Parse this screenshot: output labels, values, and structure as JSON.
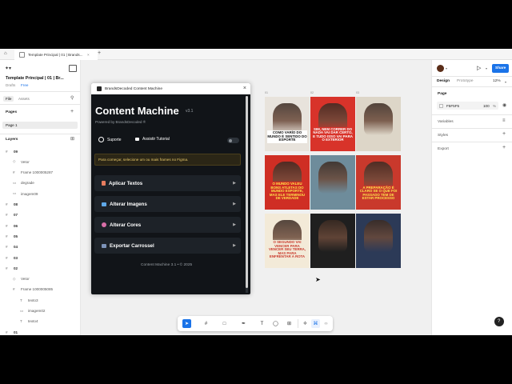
{
  "browser_tab": {
    "title": "Template Principal | 01 | Brands..."
  },
  "file": {
    "name": "Template Principal | 01 | Br...",
    "status": "Drafts",
    "plan": "Free"
  },
  "left_tabs": {
    "file": "File",
    "assets": "Assets"
  },
  "pages": {
    "title": "Pages",
    "items": [
      "Page 1"
    ]
  },
  "layers": {
    "title": "Layers",
    "items": [
      {
        "label": "09",
        "indent": 0,
        "kind": "frame"
      },
      {
        "label": "Vetor",
        "indent": 1,
        "kind": "vector"
      },
      {
        "label": "Frame 1000005287",
        "indent": 1,
        "kind": "frame"
      },
      {
        "label": "degrade",
        "indent": 1,
        "kind": "rect"
      },
      {
        "label": "imagem09",
        "indent": 1,
        "kind": "rect"
      },
      {
        "label": "08",
        "indent": 0,
        "kind": "frame"
      },
      {
        "label": "07",
        "indent": 0,
        "kind": "frame"
      },
      {
        "label": "06",
        "indent": 0,
        "kind": "frame"
      },
      {
        "label": "05",
        "indent": 0,
        "kind": "frame"
      },
      {
        "label": "04",
        "indent": 0,
        "kind": "frame"
      },
      {
        "label": "03",
        "indent": 0,
        "kind": "frame"
      },
      {
        "label": "02",
        "indent": 0,
        "kind": "frame"
      },
      {
        "label": "Vetor",
        "indent": 1,
        "kind": "vector"
      },
      {
        "label": "Frame 1000005085",
        "indent": 1,
        "kind": "frame"
      },
      {
        "label": "texto3",
        "indent": 2,
        "kind": "text"
      },
      {
        "label": "imagem02",
        "indent": 2,
        "kind": "rect"
      },
      {
        "label": "texto4",
        "indent": 2,
        "kind": "text"
      },
      {
        "label": "01",
        "indent": 0,
        "kind": "frame"
      }
    ]
  },
  "plugin": {
    "window_title": "BrandsDecoded Content Machine",
    "title": "Content Machine",
    "version": "v3.1",
    "powered": "Powered by BrandsDecoded ®",
    "support": "Suporte",
    "tutorial": "Assistir Tutorial",
    "notice": "Para começar, selecione um ou mais frames no Figma.",
    "actions": [
      "Aplicar Textos",
      "Alterar Imagens",
      "Alterar Cores",
      "Exportar Carrossel"
    ],
    "footer": "Content Machine 3.1 • © 2025"
  },
  "canvas": {
    "frame_labels": [
      "01",
      "02",
      "03"
    ],
    "thumbs": [
      {
        "headline": "COMO VARÍO DO MUNDO É SENTIDO DO ESPORTE",
        "bg": "#e8e3dc",
        "fg": "#111111",
        "band": "#ffffff"
      },
      {
        "headline": "SIM, NEM CORRER DO NADA VAI DAR CERTO, E TUDO ISSO VAI PARA O EXTERIOR",
        "bg": "#d8332a",
        "fg": "#ffffff",
        "band": "#d8332a"
      },
      {
        "headline": "",
        "bg": "#ddd6c8",
        "fg": "#111111",
        "band": "#f2efe9"
      },
      {
        "headline": "O MUNDO VALEU BONS ATLETAS DO MUNDO ESPORTE, MAS ELE TERMINOU DE VERDADE",
        "bg": "#cf2e24",
        "fg": "#ffe14a",
        "band": "#cf2e24"
      },
      {
        "headline": "",
        "bg": "#6e8c9b",
        "fg": "#111111",
        "band": "#ffffff"
      },
      {
        "headline": "A PREPARAÇÃO É CLARO SE O QUE FOI PASSADO TEM DE ESTAR PROCESSO",
        "bg": "#c9392c",
        "fg": "#ffe14a",
        "band": "#c9392c"
      },
      {
        "headline": "O SEGUNDO VAI VENCER PARA VENCER SEU TERRA, MAS PARA ENFRENTAR A ROTA",
        "bg": "#f3ead8",
        "fg": "#c9392c",
        "band": "#f3ead8"
      },
      {
        "headline": "",
        "bg": "#1f1f1f",
        "fg": "#ffffff",
        "band": "#f2efe9"
      },
      {
        "headline": "",
        "bg": "#2c3a57",
        "fg": "#ffffff",
        "band": "#f2efe9"
      }
    ]
  },
  "toolbar": {
    "items": [
      "move-tool",
      "frame-tool",
      "shape-tool",
      "pen-tool",
      "text-tool",
      "comment-tool",
      "actions-tool",
      "component-tool",
      "dev-mode-tool",
      "code-tool"
    ]
  },
  "right": {
    "share": "Share",
    "tab_design": "Design",
    "tab_prototype": "Prototype",
    "zoom": "12%",
    "page_section": "Page",
    "page_color": "F5F5F5",
    "page_opacity": "100",
    "page_opacity_unit": "%",
    "variables": "Variables",
    "styles": "Styles",
    "export": "Export"
  },
  "help": "?"
}
